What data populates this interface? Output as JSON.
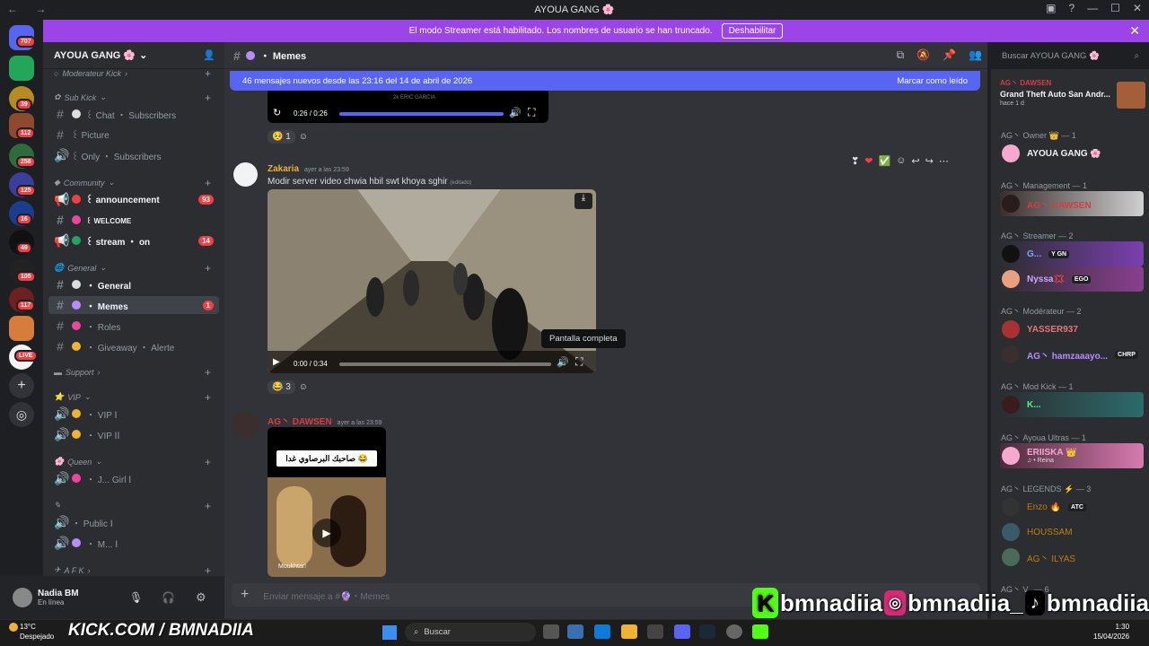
{
  "window": {
    "title": "AYOUA GANG 🌸"
  },
  "streamer_bar": {
    "text": "El modo Streamer está habilitado. Los nombres de usuario se han truncado.",
    "button": "Deshabilitar"
  },
  "guild_badges": [
    "707",
    "39",
    "112",
    "258",
    "125",
    "16",
    "49",
    "105",
    "117",
    "LIVE"
  ],
  "server": {
    "name": "AYOUA GANG 🌸"
  },
  "channels": {
    "categories": {
      "moderateur": "Moderateur Kick",
      "subkick": "Sub Kick",
      "community": "Community",
      "general": "General",
      "support": "Support",
      "vip": "VIP",
      "queen": "Queen",
      "afk": "A F K"
    },
    "items": [
      {
        "label": "꒰ Chat ・ Subscribers"
      },
      {
        "label": "꒰ Picture"
      },
      {
        "label": "꒰ Only ・ Subscribers"
      },
      {
        "label": "꒰ announcement",
        "badge": "93"
      },
      {
        "label": "꒰ WELCOME"
      },
      {
        "label": "꒰ stream ・ on",
        "badge": "14"
      },
      {
        "label": "・ General"
      },
      {
        "label": "・ Memes",
        "badge": "1"
      },
      {
        "label": "・ Roles"
      },
      {
        "label": "・ Giveaway ・ Alerte"
      },
      {
        "label": "・ VIP Ⅰ"
      },
      {
        "label": "・ VIP ⅠⅠ"
      },
      {
        "label": "・ J... Girl Ⅰ"
      },
      {
        "label": "・ Public Ⅰ"
      },
      {
        "label": "・ M... Ⅰ"
      }
    ]
  },
  "user_panel": {
    "name": "Nadia BM",
    "status": "En línea"
  },
  "channel_header": {
    "name": "・ Memes"
  },
  "new_messages": {
    "text": "46 mensajes nuevos desde las 23:16 del 14 de abril de 2026",
    "mark_read": "Marcar como leído"
  },
  "search": {
    "placeholder": "Buscar AYOUA GANG 🌸"
  },
  "messages": {
    "top_video": {
      "time": "0:26 / 0:26",
      "watermark": "2k ERIC GARCIA",
      "reaction_count": "1"
    },
    "msg1": {
      "author": "Zakaria",
      "time": "ayer a las 23:59",
      "text": "Modir server video chwia hbil swt khoya sghir",
      "edited": "(editado)",
      "video_time": "0:00 / 0:34",
      "reaction_count": "3",
      "tooltip": "Pantalla completa"
    },
    "msg2": {
      "author": "AG丶 DAWSEN",
      "time": "ayer a las 23:59",
      "image_caption": "صاحبك البرصاوي غدا 😂",
      "image_footer": "Moukhtar!"
    }
  },
  "composer": {
    "placeholder": "Enviar mensaje a #🔮・Memes"
  },
  "activity": {
    "user": "AG丶 DAWSEN",
    "game": "Grand Theft Auto San Andr...",
    "since": "hace 1 d"
  },
  "members": {
    "groups": [
      {
        "label": "AG丶 Owner 👑 — 1"
      },
      {
        "label": "AG丶 Management — 1"
      },
      {
        "label": "AG丶 Streamer — 2"
      },
      {
        "label": "AG丶 Modérateur — 2"
      },
      {
        "label": "AG丶 Mod Kick — 1"
      },
      {
        "label": "AG丶 Ayoua Ultras — 1"
      },
      {
        "label": "AG丶 LEGENDS ⚡ — 3"
      },
      {
        "label": "AG丶 V.. — 6"
      }
    ],
    "list": [
      {
        "name": "AYOUA GANG 🌸",
        "color": "#f2f3f5"
      },
      {
        "name": "AG丶 DAWSEN",
        "color": "#d83c3e"
      },
      {
        "name": "G...",
        "tag": "Y GN",
        "color": "#7aa7ff"
      },
      {
        "name": "Nyssa💢",
        "tag": "EGO",
        "color": "#c9a7ff"
      },
      {
        "name": "YASSER937",
        "color": "#e87575"
      },
      {
        "name": "AG丶 hamzaaayo...",
        "tag": "CHRP",
        "color": "#b98bff"
      },
      {
        "name": "K...",
        "color": "#57f287"
      },
      {
        "name": "ERIISKA 👑",
        "sub": "♫ • Reina",
        "color": "#f7a8d0"
      },
      {
        "name": "Enzo 🔥",
        "tag": "ATC",
        "color": "#c27c0e"
      },
      {
        "name": "HOUSSAM",
        "color": "#c27c0e"
      },
      {
        "name": "AG丶 ILYAS",
        "color": "#c27c0e"
      }
    ]
  },
  "overlay": {
    "kick": "bmnadiia",
    "instagram": "bmnadiia_",
    "tiktok": "bmnadiia",
    "kick_url": "KICK.COM / BMNADIIA"
  },
  "taskbar": {
    "weather_temp": "13°C",
    "weather_text": "Despejado",
    "search": "Buscar",
    "time": "1:30",
    "date": "15/04/2026"
  },
  "colors": {
    "accent": "#5865f2",
    "streamer_bar": "#9b45e8",
    "badge": "#f23f43"
  }
}
